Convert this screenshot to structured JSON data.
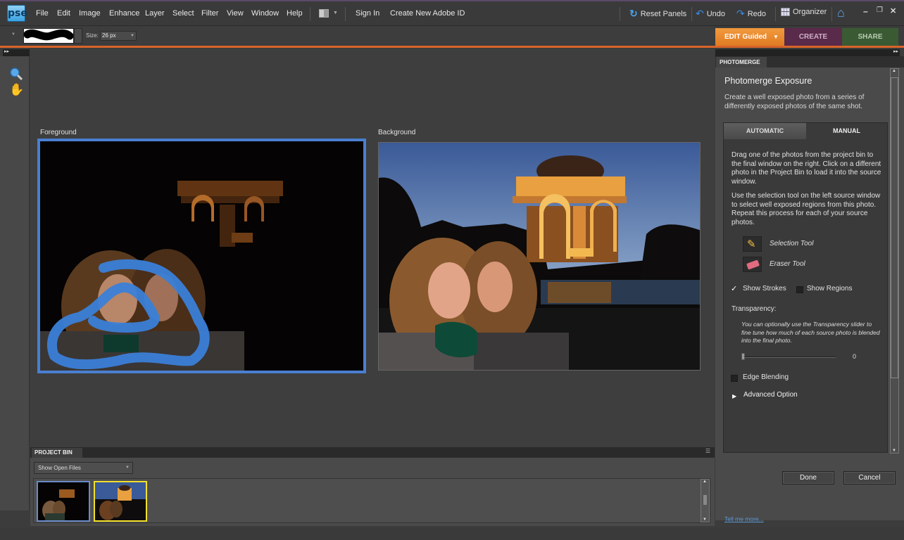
{
  "app": {
    "logo_text": "pse",
    "menu": [
      "File",
      "Edit",
      "Image",
      "Enhance",
      "Layer",
      "Select",
      "Filter",
      "View",
      "Window",
      "Help"
    ],
    "sign_in": "Sign In",
    "create_id": "Create New Adobe ID",
    "reset_panels": "Reset Panels",
    "undo": "Undo",
    "redo": "Redo",
    "organizer": "Organizer"
  },
  "options_bar": {
    "size_label": "Size:",
    "size_value": "26 px"
  },
  "mode_tabs": {
    "edit": "EDIT Guided",
    "create": "CREATE",
    "share": "SHARE"
  },
  "canvas": {
    "foreground_label": "Foreground",
    "background_label": "Background"
  },
  "project_bin": {
    "title": "PROJECT BIN",
    "filter": "Show Open Files",
    "thumbnails": [
      {
        "name": "dark-exposure-photo",
        "selected": false
      },
      {
        "name": "bright-exposure-photo",
        "selected": true
      }
    ]
  },
  "panel": {
    "tab": "PHOTOMERGE",
    "title": "Photomerge Exposure",
    "description": "Create a well exposed photo from a series of differently exposed photos of the same shot.",
    "mode_automatic": "AUTOMATIC",
    "mode_manual": "MANUAL",
    "active_mode": "MANUAL",
    "para1": "Drag one of the photos from the project bin to the final window on the right. Click on a different photo in the Project Bin to load it into the source window.",
    "para2": "Use the selection tool on the left source window to select well exposed regions from this photo. Repeat this process for each of your source photos.",
    "selection_tool": "Selection Tool",
    "eraser_tool": "Eraser Tool",
    "show_strokes": "Show Strokes",
    "show_strokes_checked": true,
    "show_regions": "Show Regions",
    "show_regions_checked": false,
    "transparency_label": "Transparency:",
    "transparency_desc": "You can optionally use the Transparency slider to fine tune how much of each source photo is blended into the final photo.",
    "transparency_value": "0",
    "edge_blending": "Edge Blending",
    "edge_blending_checked": false,
    "advanced_option": "Advanced Option",
    "done": "Done",
    "cancel": "Cancel",
    "tell_me_more": "Tell me more..."
  },
  "colors": {
    "accent_orange": "#e07a22",
    "selection_blue": "#4a7fd0",
    "stroke_blue": "#3a7fd8",
    "thumb_selected": "#f2e02a"
  }
}
